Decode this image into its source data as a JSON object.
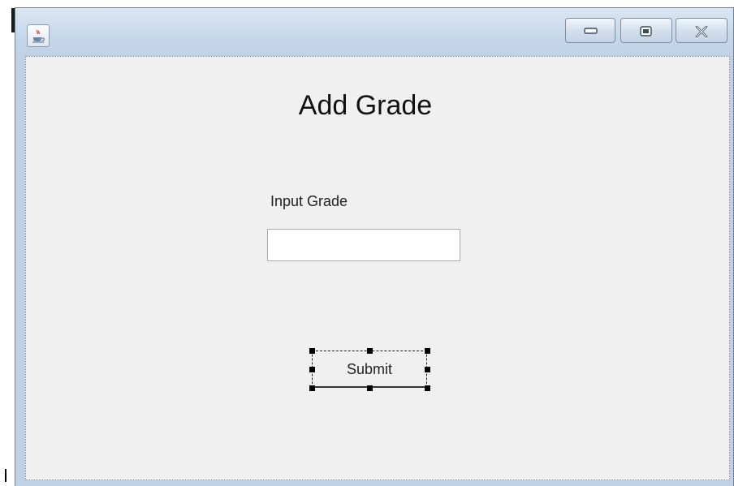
{
  "window": {
    "title_icon": "java-cup-icon",
    "controls": {
      "minimize_icon": "minimize-icon",
      "maximize_icon": "maximize-icon",
      "close_icon": "close-icon"
    }
  },
  "form": {
    "heading": "Add Grade",
    "grade_label": "Input Grade",
    "grade_value": "",
    "submit_label": "Submit"
  },
  "colors": {
    "title_bar": "#c9d9ec",
    "content_bg": "#f0f0f0",
    "selection_handles": "#000000"
  }
}
